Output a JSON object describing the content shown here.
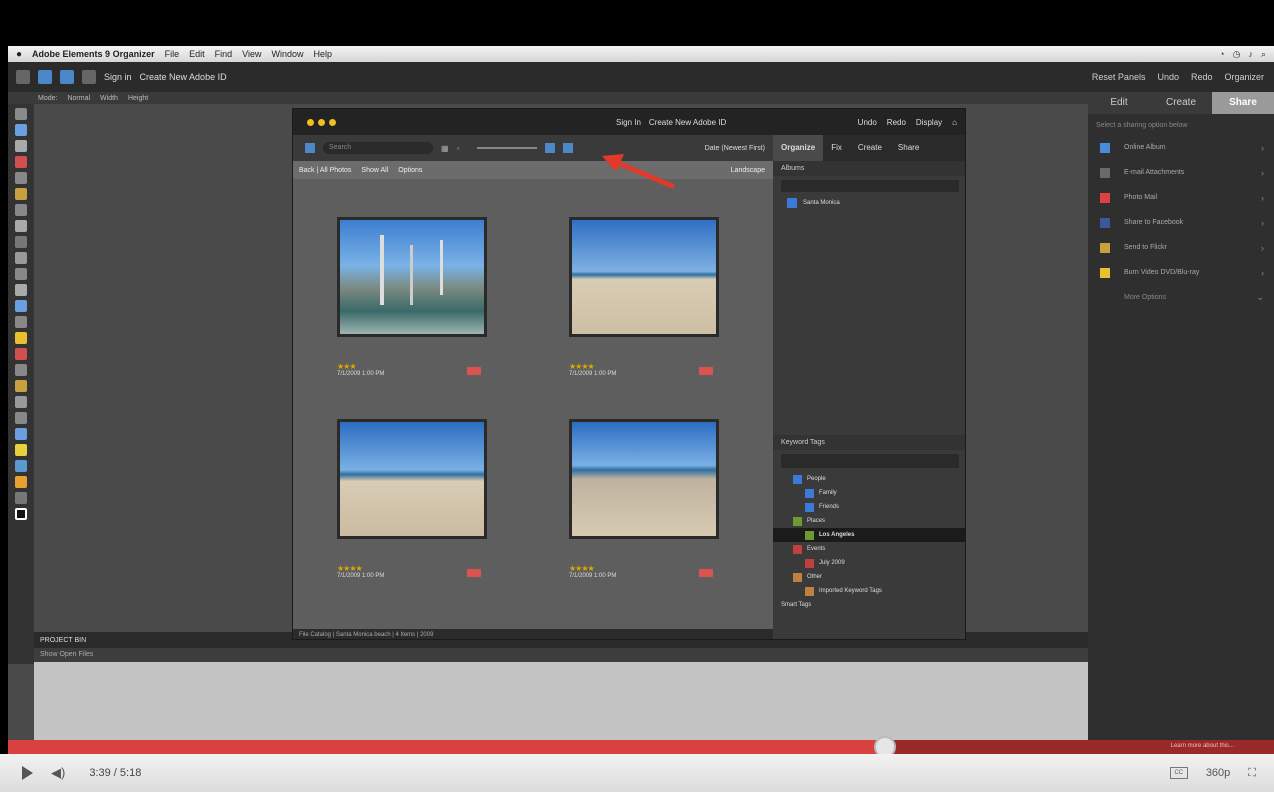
{
  "mac_menu": {
    "app_name": "Adobe Elements 9 Organizer",
    "items": [
      "File",
      "Edit",
      "Find",
      "View",
      "Window",
      "Help"
    ]
  },
  "editor_bar": {
    "sign_in": "Sign in",
    "create_account": "Create New Adobe ID",
    "right_items": [
      "Reset Panels",
      "Undo",
      "Redo",
      "Organizer"
    ]
  },
  "options_bar": {
    "items": [
      "Mode:",
      "Normal",
      "Width",
      "Height"
    ]
  },
  "right_panel": {
    "tabs": [
      "Edit",
      "Create",
      "Share"
    ],
    "hint": "Select a sharing option below",
    "items": [
      "Online Album",
      "E-mail Attachments",
      "Photo Mail",
      "Share to Facebook",
      "Send to Flickr",
      "Burn Video DVD/Blu-ray",
      "More Options"
    ]
  },
  "project_bin": {
    "title": "PROJECT BIN",
    "sub": "Show Open Files"
  },
  "organizer": {
    "title_links": [
      "Sign In",
      "Create New Adobe ID"
    ],
    "title_right": [
      "Undo",
      "Redo",
      "Display"
    ],
    "search_placeholder": "Search",
    "sort": "Date (Newest First)",
    "filter": [
      "Back | All Photos",
      "Show All",
      "Options"
    ],
    "filter_right": "Landscape",
    "tabs": [
      "Organize",
      "Fix",
      "Create",
      "Share"
    ],
    "albums_title": "Albums",
    "album_item": "Santa Monica",
    "keyword_title": "Keyword Tags",
    "keywords": [
      "People",
      "Family",
      "Friends",
      "Places",
      "Los Angeles",
      "Events",
      "July 2009",
      "Other",
      "Imported Keyword Tags",
      "Smart Tags"
    ],
    "footer": "File Catalog | Santa Monica beach | 4 Items | 2009",
    "photos": [
      {
        "stars": "★★★",
        "date": "7/1/2009 1:00 PM"
      },
      {
        "stars": "★★★★",
        "date": "7/1/2009 1:00 PM"
      },
      {
        "stars": "★★★★",
        "date": "7/1/2009 1:00 PM"
      },
      {
        "stars": "★★★★",
        "date": "7/1/2009 1:00 PM"
      }
    ]
  },
  "player": {
    "time": "3:39 / 5:18",
    "quality": "360p",
    "annotation": "Learn more about this..."
  },
  "colors": {
    "accent_red": "#d94040",
    "selection_blue": "#3b7bd8",
    "stars_gold": "#e0a700"
  }
}
